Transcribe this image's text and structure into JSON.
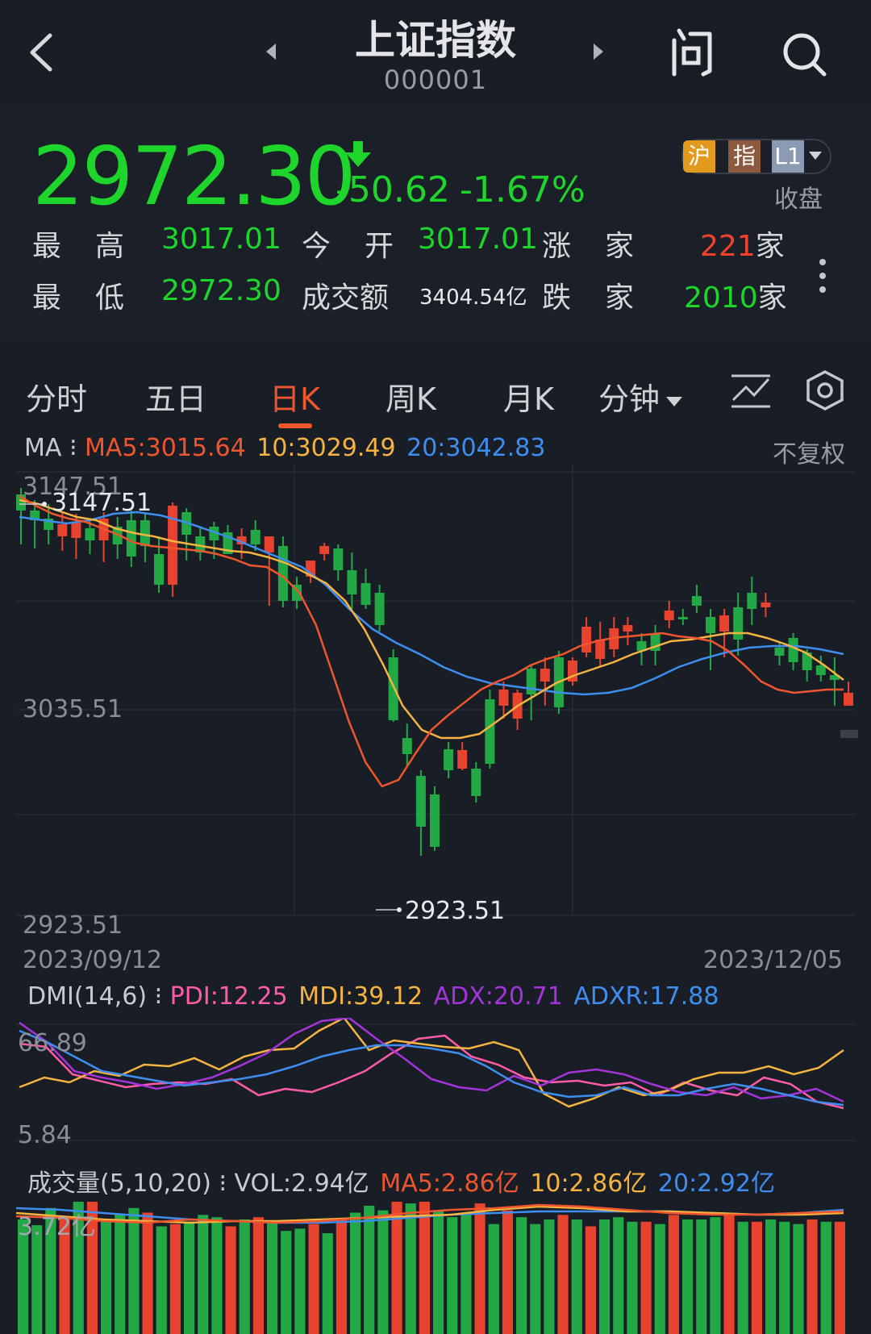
{
  "nav": {
    "title": "上证指数",
    "code": "000001"
  },
  "quote": {
    "price": "2972.30",
    "change": "-50.62",
    "change_pct": "-1.67%",
    "status": "收盘",
    "badges": {
      "market": "沪",
      "type": "指",
      "level": "L1"
    }
  },
  "stats": {
    "high_label": [
      "最",
      "高"
    ],
    "high": "3017.01",
    "open_label": [
      "今",
      "开"
    ],
    "open": "3017.01",
    "up_label": [
      "涨",
      "家"
    ],
    "up_count": "221",
    "up_unit": "家",
    "low_label": [
      "最",
      "低"
    ],
    "low": "2972.30",
    "turnover_label": "成交额",
    "turnover": "3404.54亿",
    "down_label": [
      "跌",
      "家"
    ],
    "down_count": "2010",
    "down_unit": "家"
  },
  "tabs": [
    "分时",
    "五日",
    "日K",
    "周K",
    "月K",
    "分钟"
  ],
  "ma": {
    "label": "MA",
    "ma5": "MA5:3015.64",
    "ma10": "10:3029.49",
    "ma20": "20:3042.83",
    "mode": "不复权"
  },
  "kline": {
    "y_top": "3147.51",
    "y_mid": "3035.51",
    "y_bottom": "2923.51",
    "high_marker": "3147.51",
    "low_marker": "2923.51",
    "date_start": "2023/09/12",
    "date_end": "2023/12/05"
  },
  "dmi": {
    "label": "DMI(14,6)",
    "pdi": "PDI:12.25",
    "mdi": "MDI:39.12",
    "adx": "ADX:20.71",
    "adxr": "ADXR:17.88",
    "y_top": "66.89",
    "y_bottom": "5.84"
  },
  "volume": {
    "label": "成交量(5,10,20)",
    "vol": "VOL:2.94亿",
    "ma5": "MA5:2.86亿",
    "ma10": "10:2.86亿",
    "ma20": "20:2.92亿",
    "y_top": "3.72亿"
  },
  "colors": {
    "up": "#e8432e",
    "down": "#22a845",
    "ma5": "#f0562e",
    "ma10": "#f5b340",
    "ma20": "#3e8ef0",
    "pdi": "#ff5ca8",
    "mdi": "#f5b340",
    "adx": "#a335d8",
    "adxr": "#3e8ef0"
  }
}
